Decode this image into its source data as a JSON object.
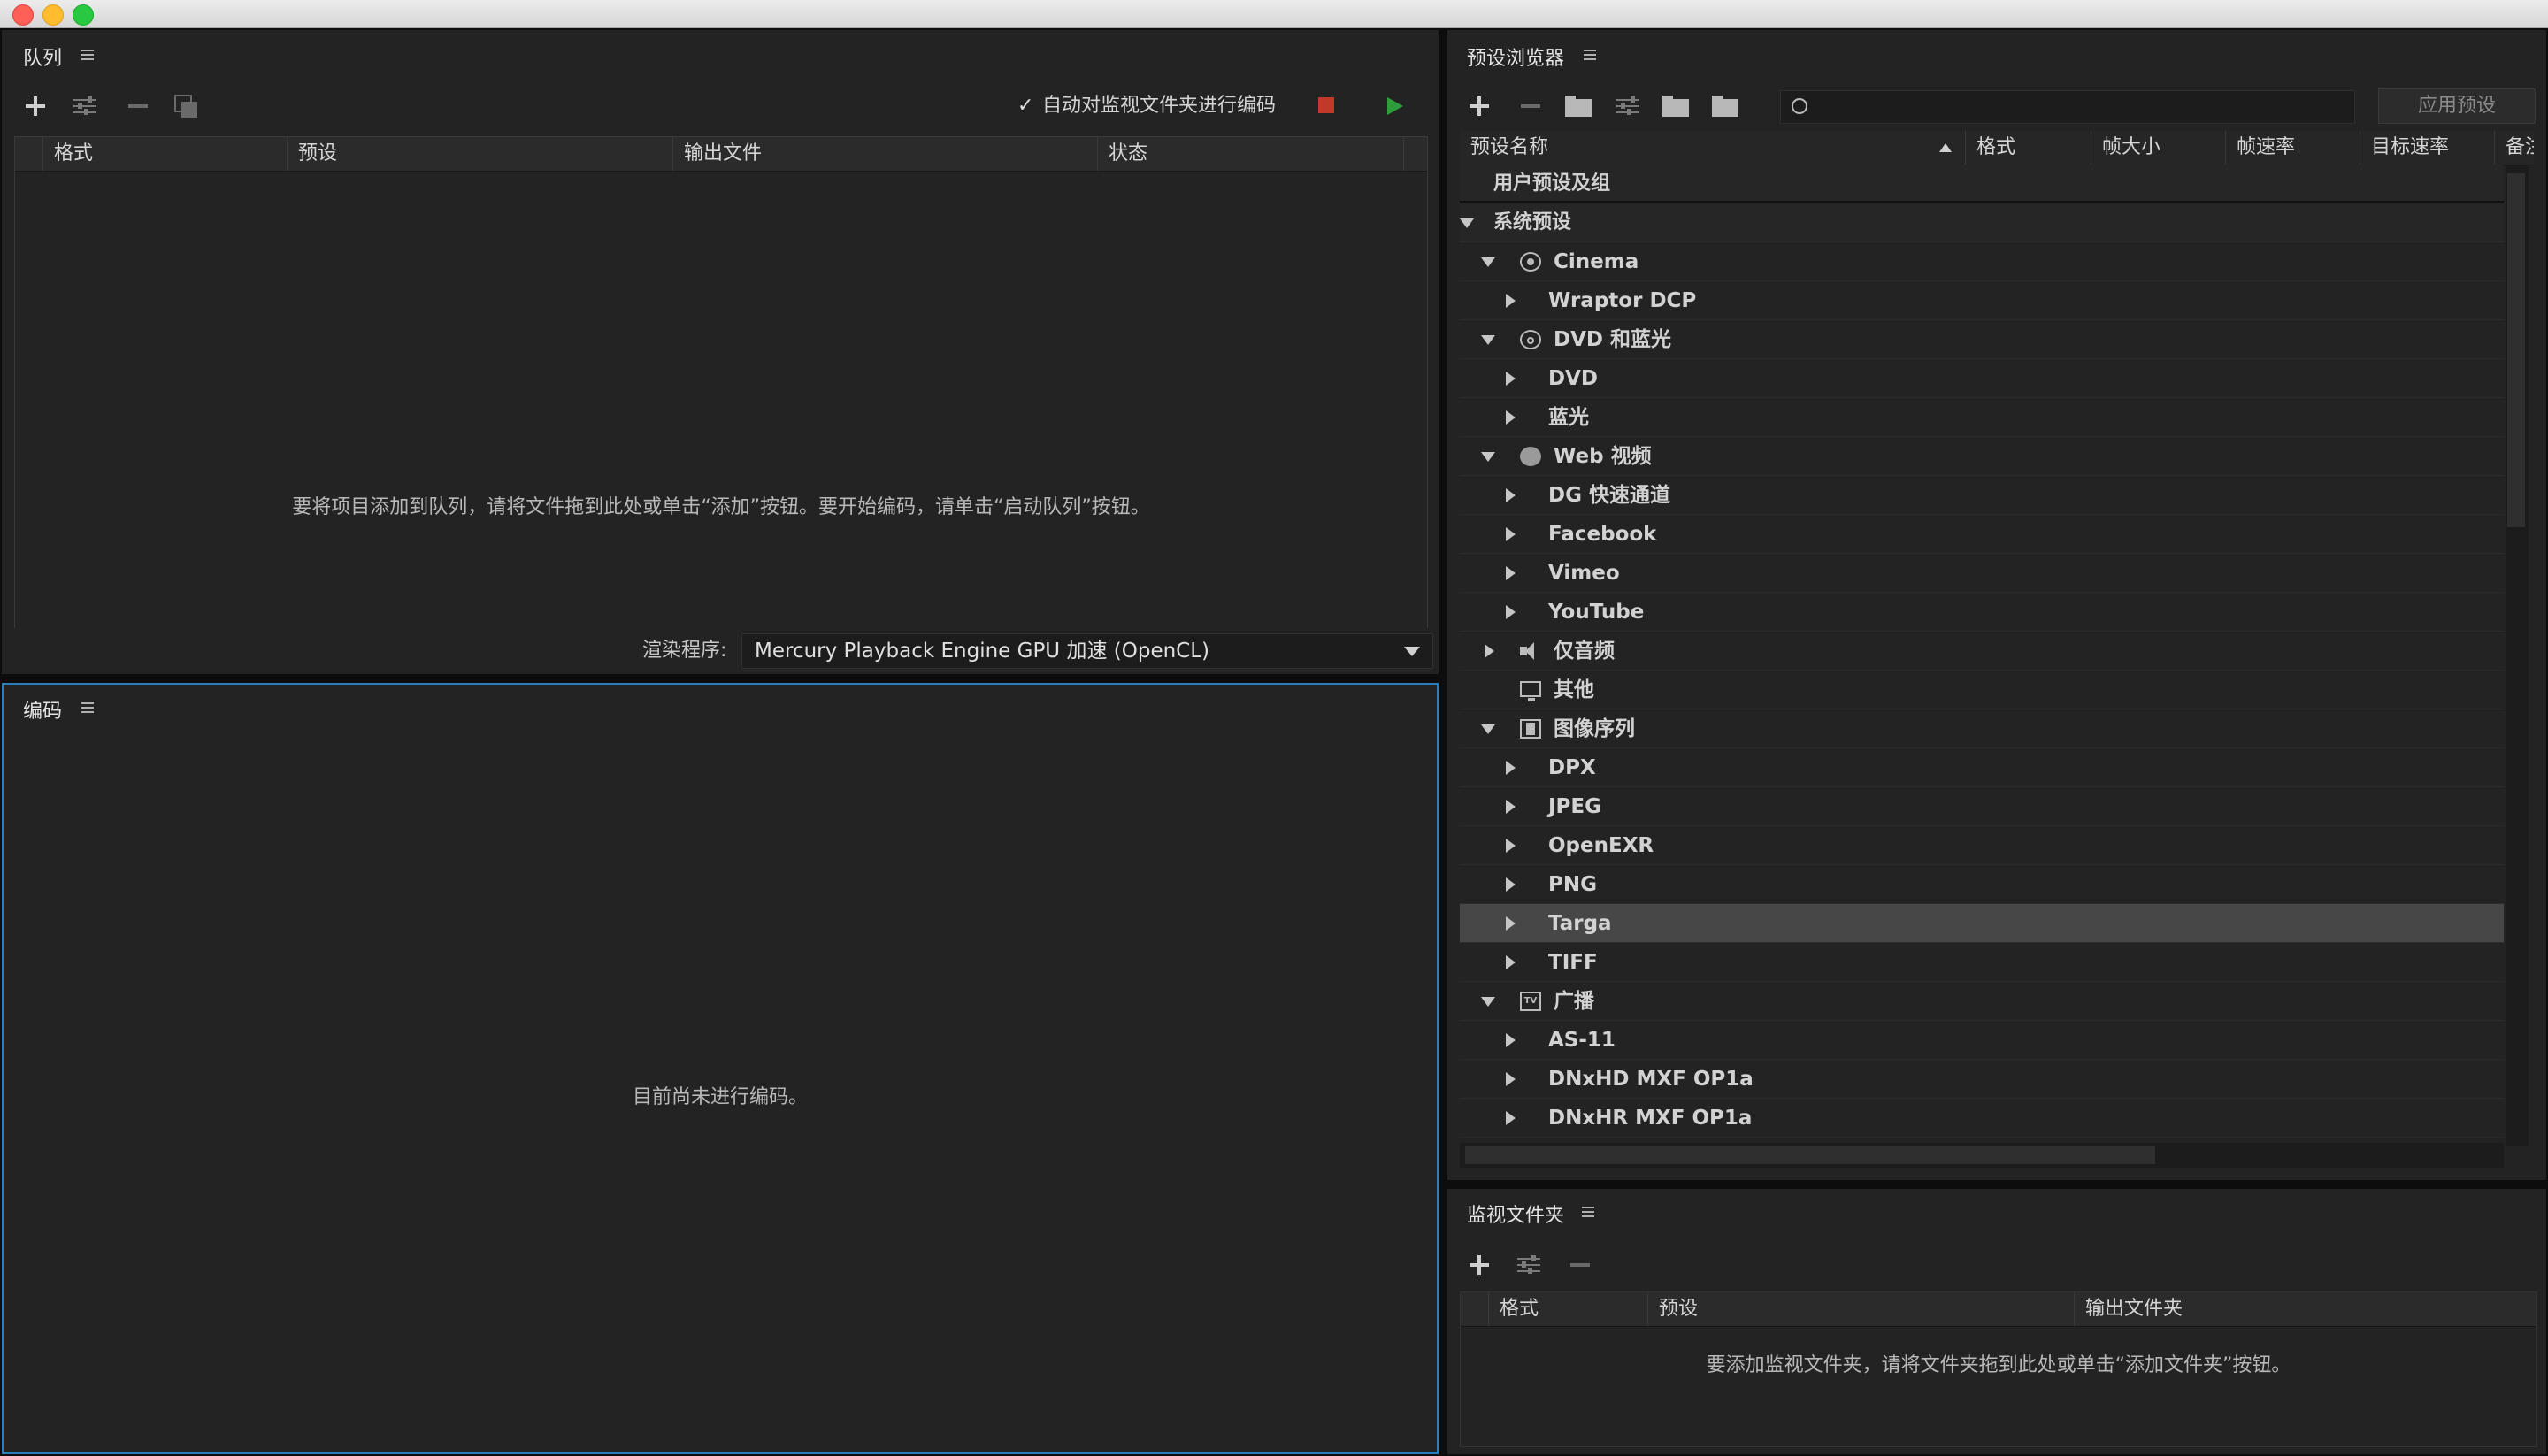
{
  "queue": {
    "title": "队列",
    "auto_encode_label": "自动对监视文件夹进行编码",
    "auto_encode_checked": true,
    "columns": [
      "格式",
      "预设",
      "输出文件",
      "状态"
    ],
    "empty_message": "要将项目添加到队列，请将文件拖到此处或单击“添加”按钮。要开始编码，请单击“启动队列”按钮。",
    "renderer_label": "渲染程序:",
    "renderer_value": "Mercury Playback Engine GPU 加速 (OpenCL)"
  },
  "encoding": {
    "title": "编码",
    "empty_message": "目前尚未进行编码。"
  },
  "preset_browser": {
    "title": "预设浏览器",
    "apply_button": "应用预设",
    "search_placeholder": "",
    "columns": [
      "预设名称",
      "格式",
      "帧大小",
      "帧速率",
      "目标速率",
      "备注"
    ],
    "user_presets": "用户预设及组",
    "system_presets": "系统预设",
    "tree": [
      {
        "label": "Cinema",
        "level": 1,
        "expanded": true,
        "icon": "cinema-icon"
      },
      {
        "label": "Wraptor DCP",
        "level": 2,
        "expanded": false
      },
      {
        "label": "DVD 和蓝光",
        "level": 1,
        "expanded": true,
        "icon": "disc-icon"
      },
      {
        "label": "DVD",
        "level": 2,
        "expanded": false
      },
      {
        "label": "蓝光",
        "level": 2,
        "expanded": false
      },
      {
        "label": "Web 视频",
        "level": 1,
        "expanded": true,
        "icon": "globe-icon"
      },
      {
        "label": "DG 快速通道",
        "level": 2,
        "expanded": false
      },
      {
        "label": "Facebook",
        "level": 2,
        "expanded": false
      },
      {
        "label": "Vimeo",
        "level": 2,
        "expanded": false
      },
      {
        "label": "YouTube",
        "level": 2,
        "expanded": false
      },
      {
        "label": "仅音频",
        "level": 1,
        "expanded": false,
        "icon": "speaker-icon"
      },
      {
        "label": "其他",
        "level": 1,
        "expanded": null,
        "icon": "monitor-icon"
      },
      {
        "label": "图像序列",
        "level": 1,
        "expanded": true,
        "icon": "film-icon"
      },
      {
        "label": "DPX",
        "level": 2,
        "expanded": false
      },
      {
        "label": "JPEG",
        "level": 2,
        "expanded": false
      },
      {
        "label": "OpenEXR",
        "level": 2,
        "expanded": false
      },
      {
        "label": "PNG",
        "level": 2,
        "expanded": false
      },
      {
        "label": "Targa",
        "level": 2,
        "expanded": false,
        "selected": true
      },
      {
        "label": "TIFF",
        "level": 2,
        "expanded": false
      },
      {
        "label": "广播",
        "level": 1,
        "expanded": true,
        "icon": "tv-icon"
      },
      {
        "label": "AS-11",
        "level": 2,
        "expanded": false
      },
      {
        "label": "DNxHD MXF OP1a",
        "level": 2,
        "expanded": false
      },
      {
        "label": "DNxHR MXF OP1a",
        "level": 2,
        "expanded": false
      }
    ]
  },
  "watch_folders": {
    "title": "监视文件夹",
    "columns": [
      "格式",
      "预设",
      "输出文件夹"
    ],
    "empty_message": "要添加监视文件夹，请将文件夹拖到此处或单击“添加文件夹”按钮。"
  },
  "colors": {
    "accent_focus": "#2a7fb8",
    "stop_red": "#c0392b",
    "play_green": "#2e9e3a"
  }
}
